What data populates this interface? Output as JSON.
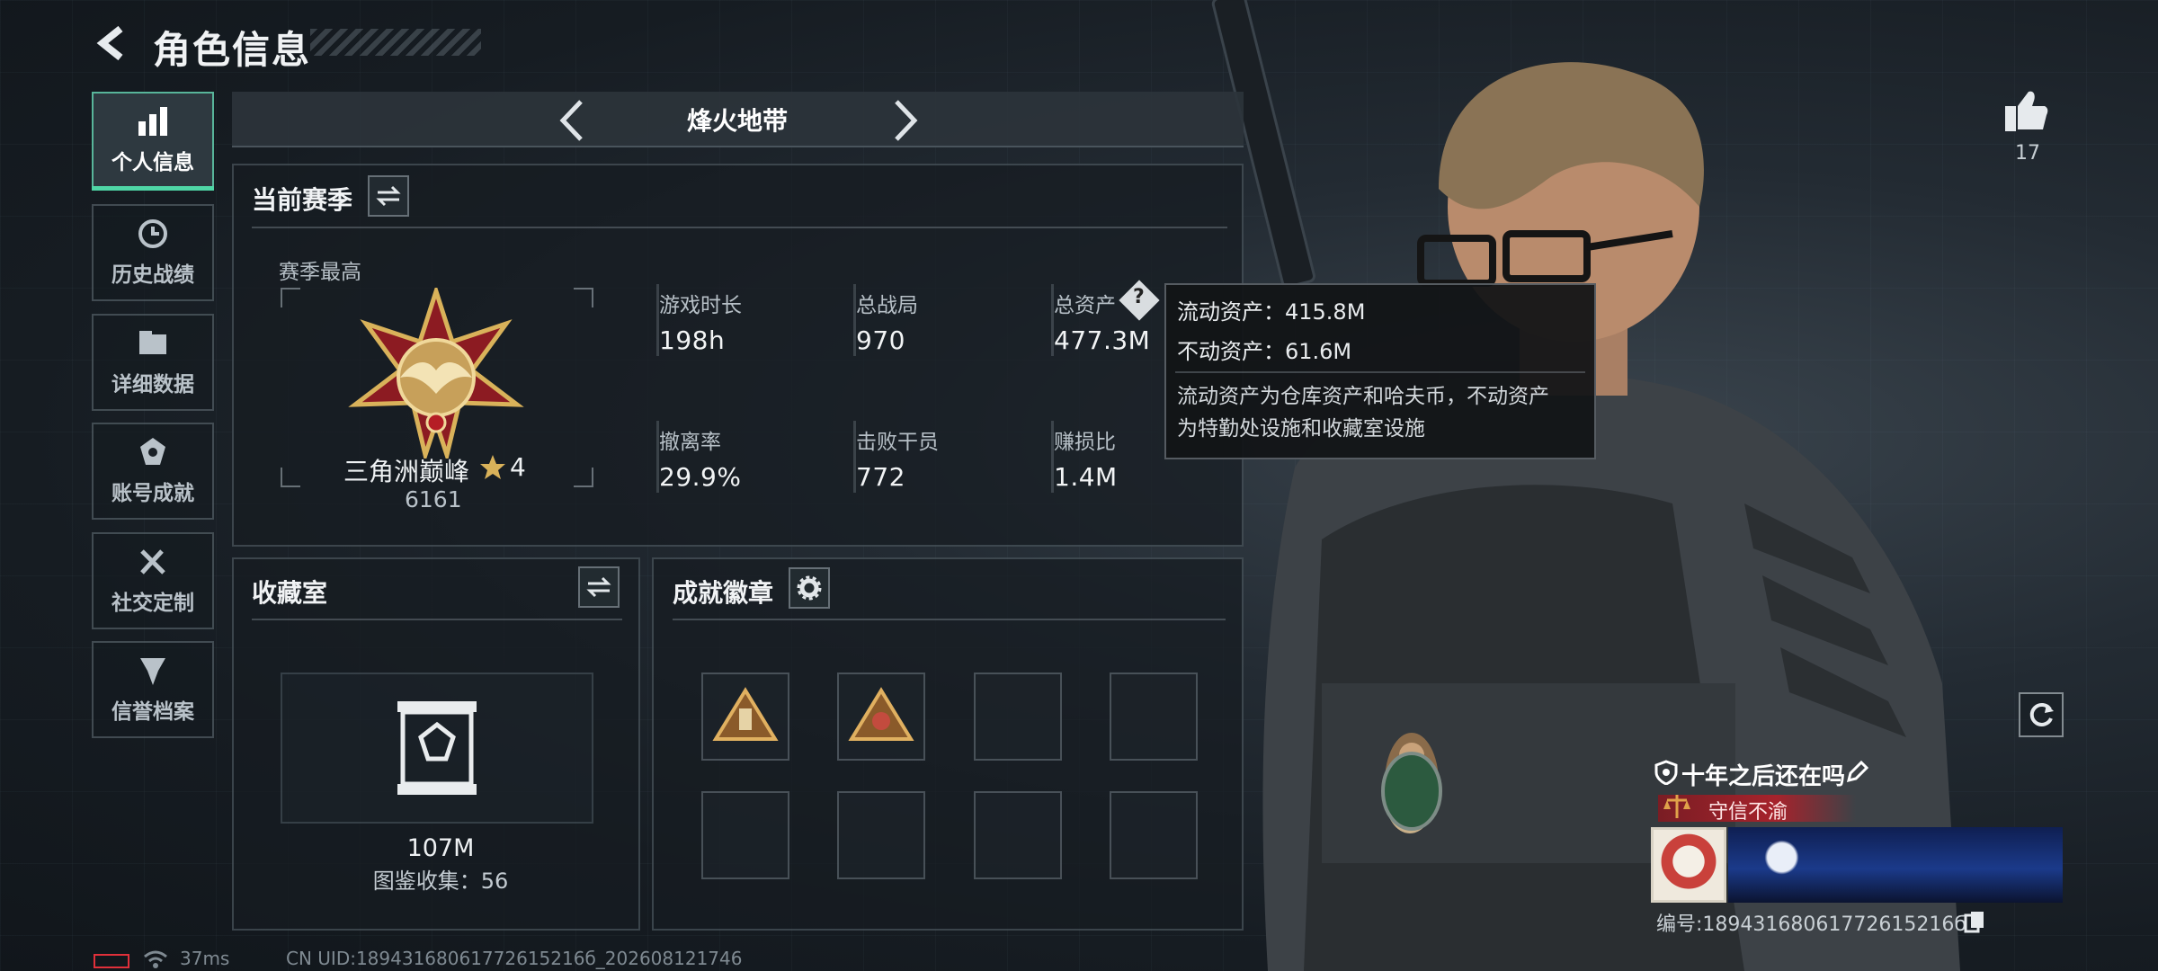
{
  "header": {
    "title": "角色信息"
  },
  "sidebar": {
    "items": [
      {
        "label": "个人信息",
        "active": true,
        "icon": "bar-chart-icon"
      },
      {
        "label": "历史战绩",
        "active": false,
        "icon": "history-clock-icon"
      },
      {
        "label": "详细数据",
        "active": false,
        "icon": "folder-icon"
      },
      {
        "label": "账号成就",
        "active": false,
        "icon": "achievement-icon"
      },
      {
        "label": "社交定制",
        "active": false,
        "icon": "tools-icon"
      },
      {
        "label": "信誉档案",
        "active": false,
        "icon": "shield-emblem-icon"
      }
    ]
  },
  "mode": {
    "title": "烽火地带"
  },
  "season": {
    "title": "当前赛季",
    "best_label": "赛季最高",
    "rank_name": "三角洲巅峰",
    "rank_stars": "4",
    "rank_points": "6161",
    "stats": [
      {
        "label": "游戏时长",
        "value": "198h"
      },
      {
        "label": "总战局",
        "value": "970"
      },
      {
        "label": "总资产",
        "value": "477.3M"
      },
      {
        "label": "撤离率",
        "value": "29.9%"
      },
      {
        "label": "击败干员",
        "value": "772"
      },
      {
        "label": "赚损比",
        "value": "1.4M"
      }
    ]
  },
  "tooltip": {
    "liquid": "流动资产：415.8M",
    "fixed": "不动资产：61.6M",
    "desc1": "流动资产为仓库资产和哈夫币，不动资产",
    "desc2": "为特勤处设施和收藏室设施"
  },
  "collection": {
    "title": "收藏室",
    "value": "107M",
    "count": "图鉴收集：56"
  },
  "badges": {
    "title": "成就徽章"
  },
  "profile": {
    "likes": "17",
    "name": "十年之后还在吗",
    "banner": "守信不渝",
    "id": "编号:18943168061772615216б"
  },
  "status": {
    "ping": "37ms",
    "uid": "CN UID:18943168061772615216б_202608121746"
  },
  "colors": {
    "accent": "#4fd6a6",
    "banner_red": "#a6232c",
    "gold": "#d9b25a"
  }
}
